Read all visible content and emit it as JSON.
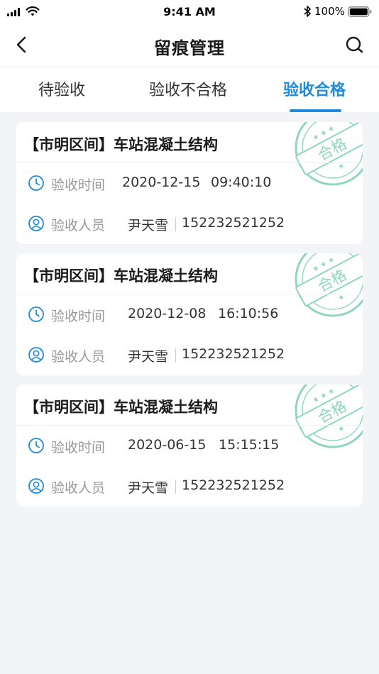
{
  "status_bar": {
    "time": "9:41 AM",
    "battery": "100%"
  },
  "nav": {
    "title": "留痕管理",
    "back_icon": "chevron-left-icon",
    "search_icon": "search-icon"
  },
  "tabs": [
    {
      "label": "待验收",
      "active": false
    },
    {
      "label": "验收不合格",
      "active": false
    },
    {
      "label": "验收合格",
      "active": true
    }
  ],
  "colors": {
    "accent": "#1e8cdb",
    "stamp": "#8fd6bd",
    "background": "#f2f4f8"
  },
  "labels": {
    "time_label": "验收时间",
    "person_label": "验收人员"
  },
  "cards": [
    {
      "title": "【市明区间】车站混凝土结构",
      "date": "2020-12-15",
      "time": "09:40:10",
      "person": "尹天雪",
      "phone": "152232521252",
      "stamp": "合格"
    },
    {
      "title": "【市明区间】车站混凝土结构",
      "date": "2020-12-08",
      "time": "16:10:56",
      "person": "尹天雪",
      "phone": "152232521252",
      "stamp": "合格"
    },
    {
      "title": "【市明区间】车站混凝土结构",
      "date": "2020-06-15",
      "time": "15:15:15",
      "person": "尹天雪",
      "phone": "152232521252",
      "stamp": "合格"
    }
  ]
}
